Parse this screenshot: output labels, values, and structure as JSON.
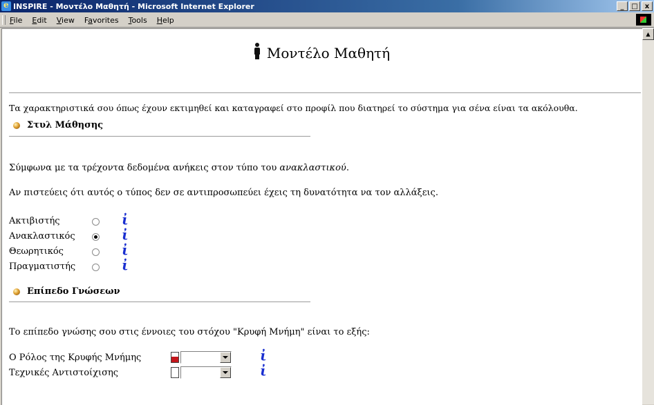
{
  "window": {
    "title": "INSPIRE - Μοντέλο Μαθητή - Microsoft Internet Explorer",
    "controls": {
      "minimize": "_",
      "maximize": "□",
      "close": "x"
    }
  },
  "menu": {
    "items": [
      {
        "mnemonic": "F",
        "rest": "ile"
      },
      {
        "mnemonic": "E",
        "rest": "dit"
      },
      {
        "mnemonic": "V",
        "rest": "iew"
      },
      {
        "pre": "F",
        "mnemonic": "a",
        "rest": "vorites"
      },
      {
        "mnemonic": "T",
        "rest": "ools"
      },
      {
        "mnemonic": "H",
        "rest": "elp"
      }
    ]
  },
  "page": {
    "title": "Μοντέλο Μαθητή",
    "intro": "Τα χαρακτηριστικά σου όπως έχουν εκτιμηθεί και καταγραφεί στο προφίλ που διατηρεί το σύστημα για σένα είναι τα ακόλουθα.",
    "learning_style": {
      "heading": "Στυλ Μάθησης",
      "current_prefix": "Σύμφωνα με τα τρέχοντα δεδομένα ανήκεις στον τύπο του ",
      "current_type": "ανακλαστικού",
      "current_suffix": ".",
      "change_text": "Αν πιστεύεις ότι αυτός ο τύπος δεν σε αντιπροσωπεύει έχεις τη δυνατότητα να τον αλλάξεις.",
      "options": [
        {
          "label": "Ακτιβιστής",
          "checked": false,
          "info": "ἰ"
        },
        {
          "label": "Ανακλαστικός",
          "checked": true,
          "info": "ἰ"
        },
        {
          "label": "Θεωρητικός",
          "checked": false,
          "info": "ἰ"
        },
        {
          "label": "Πραγματιστής",
          "checked": false,
          "info": "ἰ"
        }
      ]
    },
    "knowledge_level": {
      "heading": "Επίπεδο Γνώσεων",
      "text": "Το επίπεδο γνώσης σου στις έννοιες του στόχου \"Κρυφή Μνήμη\" είναι το εξής:",
      "concepts": [
        {
          "label": "Ο Ρόλος της Κρυφής Μνήμης",
          "level": 0.55,
          "selected": "",
          "info": "ἰ"
        },
        {
          "label": "Τεχνικές Αντιστοίχισης",
          "level": 0.0,
          "selected": "",
          "info": "ἰ"
        }
      ]
    }
  },
  "colors": {
    "title_bar": "#0a246a",
    "info_icon": "#1a2fd0",
    "level_fill": "#c4161c"
  }
}
